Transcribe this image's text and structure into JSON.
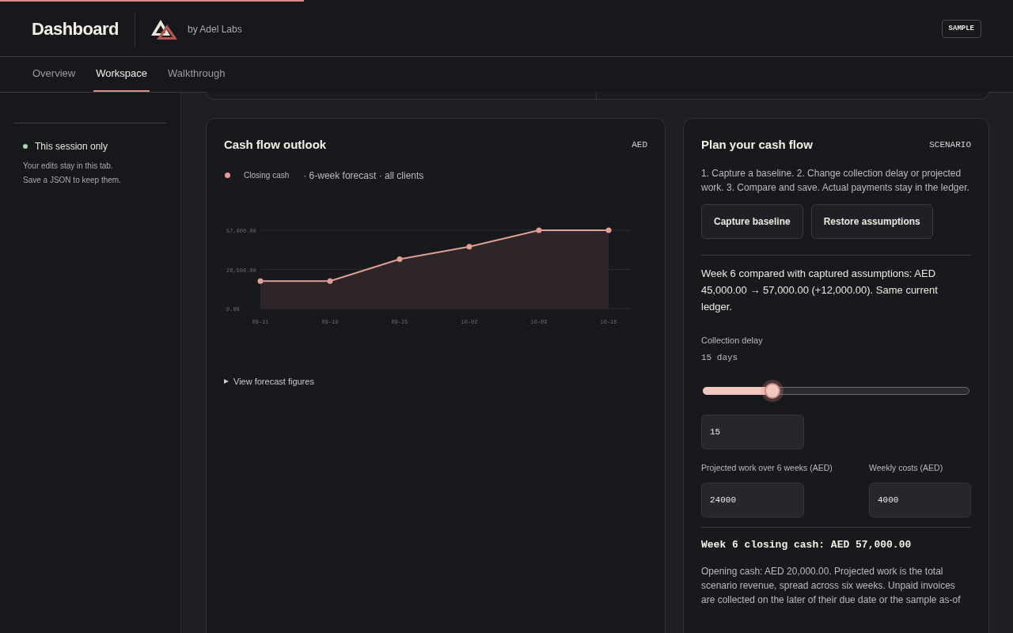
{
  "loading": {
    "level": 0.3
  },
  "header": {
    "title": "Dashboard",
    "byline": "by Adel Labs",
    "badge": "SAMPLE"
  },
  "tabs": [
    {
      "label": "Overview",
      "selected": false
    },
    {
      "label": "Workspace",
      "selected": true
    },
    {
      "label": "Walkthrough",
      "selected": false
    }
  ],
  "sidebar": {
    "status": {
      "label": "This session only",
      "color": "#a7d7a9"
    },
    "note_lines": [
      "Your edits stay in this tab.",
      "Save a JSON to keep them."
    ]
  },
  "outlook": {
    "title": "Cash flow outlook",
    "currency": "AED",
    "subtitle": "· 6-week forecast · all clients",
    "chart_data": {
      "type": "area",
      "categories": [
        "09-11",
        "09-18",
        "09-25",
        "10-02",
        "10-09",
        "10-16"
      ],
      "series": [
        {
          "name": "Closing cash",
          "color": "#e0a096",
          "values": [
            20000,
            20000,
            36000,
            45000,
            57000,
            57000
          ]
        }
      ],
      "ylim": [
        0,
        57000
      ],
      "yticks": [
        {
          "value": 0,
          "label": "0.00"
        },
        {
          "value": 28500,
          "label": "28,500.00"
        },
        {
          "value": 57000,
          "label": "57,000.00"
        }
      ]
    },
    "details": {
      "label": "View forecast figures",
      "expanded": false
    }
  },
  "plan": {
    "title": "Plan your cash flow",
    "tag": "SCENARIO",
    "steps": "1. Capture a baseline. 2. Change collection delay or projected work. 3. Compare and save. Actual payments stay in the ledger.",
    "buttons": [
      "Capture baseline",
      "Restore assumptions"
    ],
    "comparison": "Week 6 compared with captured assumptions: AED 45,000.00 → 57,000.00 (+12,000.00). Same current ledger.",
    "delay": {
      "label": "Collection delay",
      "reading": "15 days",
      "level": 0.26,
      "value": "15"
    },
    "fields": [
      {
        "label": "Projected work over 6 weeks (AED)",
        "value": "24000"
      },
      {
        "label": "Weekly costs (AED)",
        "value": "4000"
      }
    ],
    "result": "Week 6 closing cash: AED 57,000.00",
    "explanation": "Opening cash: AED 20,000.00. Projected work is the total scenario revenue, spread across six weeks. Unpaid invoices are collected on the later of their due date or the sample as-of"
  }
}
